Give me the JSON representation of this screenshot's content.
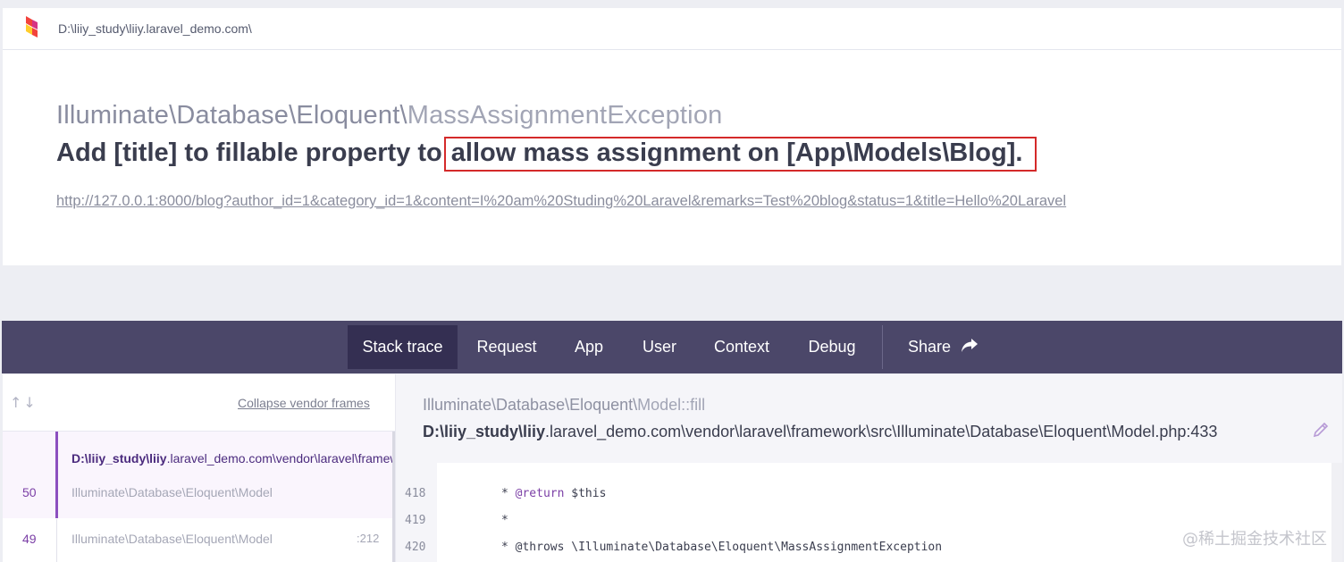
{
  "topbar": {
    "path": "D:\\liiy_study\\liiy.laravel_demo.com\\"
  },
  "exception": {
    "namespace": "Illuminate\\Database\\Eloquent\\",
    "class_name": "MassAssignmentException",
    "message_lead": "Add [title] to fillable property to",
    "message_highlighted": "allow mass assignment on [App\\Models\\Blog].",
    "highlight_color": "#d42a2a",
    "url": "http://127.0.0.1:8000/blog?author_id=1&category_id=1&content=I%20am%20Studing%20Laravel&remarks=Test%20blog&status=1&title=Hello%20Laravel"
  },
  "nav": {
    "tabs": [
      {
        "label": "Stack trace",
        "active": true
      },
      {
        "label": "Request"
      },
      {
        "label": "App"
      },
      {
        "label": "User"
      },
      {
        "label": "Context"
      },
      {
        "label": "Debug"
      }
    ],
    "share_label": "Share",
    "share_icon": "share-arrow-icon"
  },
  "stack": {
    "collapse_label": "Collapse vendor frames",
    "arrows": "↑↓",
    "frames": [
      {
        "number": "50",
        "path_bold": "D:\\liiy_study\\liiy",
        "path_rest": ".laravel_demo.com\\vendor\\laravel\\framework\\src\\Illuminate\\Database\\Eloquent\\Model.php",
        "class": "Illuminate\\Database\\Eloquent\\Model",
        "active": true
      },
      {
        "number": "49",
        "class": "Illuminate\\Database\\Eloquent\\Model",
        "line": ":212"
      }
    ]
  },
  "detail": {
    "method_namespace": "Illuminate\\Database\\Eloquent\\",
    "method_name": "Model::fill",
    "file_bold": "D:\\liiy_study\\liiy",
    "file_rest": ".laravel_demo.com\\vendor\\laravel\\framework\\src\\Illuminate\\Database\\Eloquent\\Model.php:433",
    "edit_icon": "pencil-icon"
  },
  "code": {
    "lines": [
      {
        "number": "418",
        "prefix": "* ",
        "tag": "@return",
        "rest": " $this"
      },
      {
        "number": "419",
        "prefix": "*",
        "tag": "",
        "rest": ""
      },
      {
        "number": "420",
        "prefix": "* ",
        "tag": "",
        "rest": "@throws \\Illuminate\\Database\\Eloquent\\MassAssignmentException"
      }
    ]
  },
  "watermark": "@稀土掘金技术社区",
  "colors": {
    "nav_bg": "#4b4769",
    "nav_active": "#342f52",
    "accent_purple": "#8c4fbf"
  }
}
